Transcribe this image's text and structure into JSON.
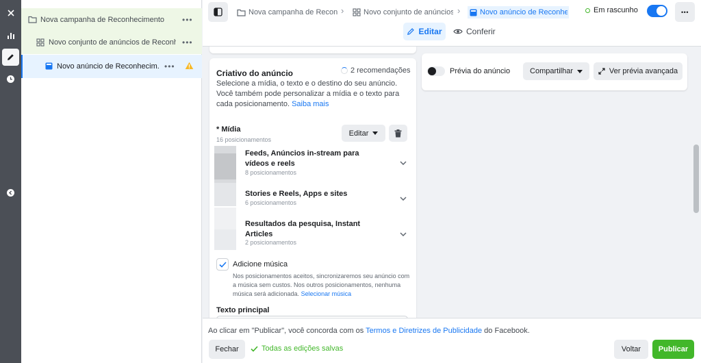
{
  "rail": {
    "items": [
      {
        "name": "close-icon"
      },
      {
        "name": "chart-icon"
      },
      {
        "name": "pencil-icon"
      },
      {
        "name": "clock-icon"
      },
      {
        "name": "collapse-icon"
      }
    ]
  },
  "tree": {
    "campaign": "Nova campanha de Reconhecimento",
    "adset": "Novo conjunto de anúncios de Reconh...",
    "ad": "Novo anúncio de Reconhecim...",
    "more": "•••"
  },
  "topbar": {
    "breadcrumb": [
      "Nova campanha de Reconhe",
      "Novo conjunto de anúncios c",
      "Novo anúncio de Reconhecir"
    ],
    "status": "Em rascunho",
    "more": "•••",
    "mode_edit": "Editar",
    "mode_view": "Conferir"
  },
  "creative": {
    "title": "Criativo do anúncio",
    "recommendations": "2 recomendações",
    "description": "Selecione a mídia, o texto e o destino do seu anúncio. Você também pode personalizar a mídia e o texto para cada posicionamento.",
    "learn_more": "Saiba mais",
    "media_label": "* Mídia",
    "media_placements": "16 posicionamentos",
    "edit_button": "Editar",
    "placements": [
      {
        "title": "Feeds, Anúncios in-stream para vídeos e reels",
        "count": "8 posicionamentos"
      },
      {
        "title": "Stories e Reels, Apps e sites",
        "count": "6 posicionamentos"
      },
      {
        "title": "Resultados da pesquisa, Instant Articles",
        "count": "2 posicionamentos"
      }
    ],
    "music_label": "Adicione música",
    "music_desc": "Nos posicionamentos aceitos, sincronizaremos seu anúncio com a música sem custos. Nos outros posicionamentos, nenhuma música será adicionada.",
    "music_link": "Selecionar música",
    "primary_text_label": "Texto principal"
  },
  "preview": {
    "label": "Prévia do anúncio",
    "share": "Compartilhar",
    "advanced": "Ver prévia avançada"
  },
  "footer": {
    "note_prefix": "Ao clicar em \"Publicar\", você concorda com os ",
    "note_link": "Termos e Diretrizes de Publicidade",
    "note_suffix": " do Facebook.",
    "close": "Fechar",
    "saved": "Todas as edições salvas",
    "back": "Voltar",
    "publish": "Publicar"
  },
  "colors": {
    "accent": "#1877f2",
    "success": "#42b72a",
    "warning": "#f7b928",
    "rail": "#4b4f56"
  }
}
